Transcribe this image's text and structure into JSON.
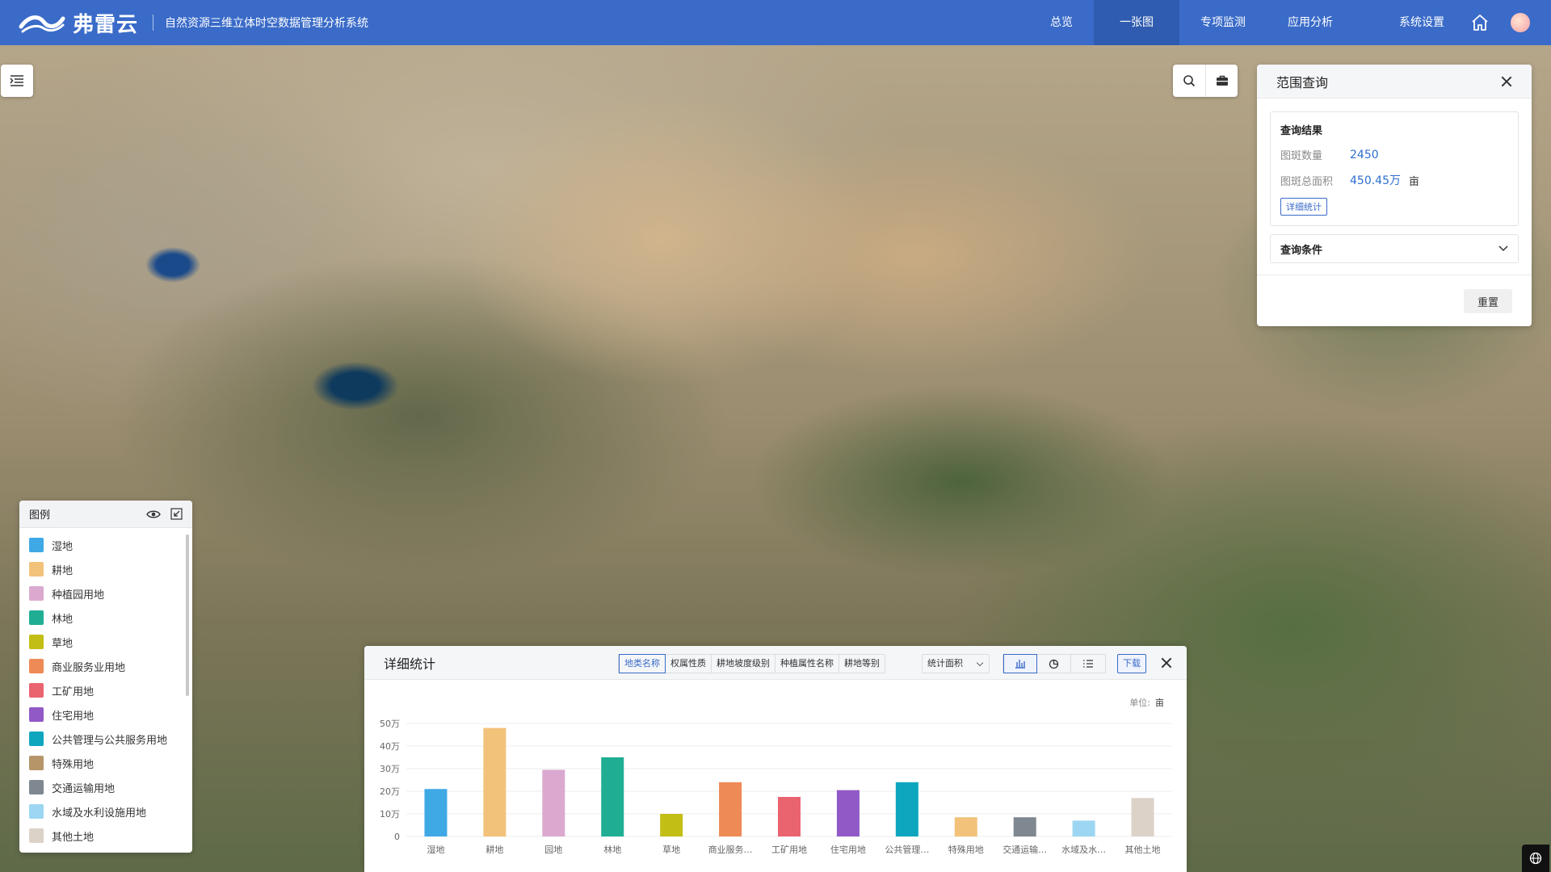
{
  "header": {
    "brand": "弗雷云",
    "system_title": "自然资源三维立体时空数据管理分析系统",
    "nav": [
      {
        "label": "总览",
        "active": false
      },
      {
        "label": "一张图",
        "active": true
      },
      {
        "label": "专项监测",
        "active": false
      },
      {
        "label": "应用分析",
        "active": false
      },
      {
        "label": "系统设置",
        "active": false
      }
    ],
    "colors": {
      "bar": "#3a6bc8",
      "active": "#2f5cb0"
    }
  },
  "range_query": {
    "title": "范围查询",
    "result_title": "查询结果",
    "count_label": "图斑数量",
    "count_value": "2450",
    "area_label": "图斑总面积",
    "area_value": "450.45万",
    "area_unit": "亩",
    "detail_button": "详细统计",
    "conditions_label": "查询条件",
    "reset_button": "重置"
  },
  "legend": {
    "title": "图例",
    "items": [
      {
        "label": "湿地",
        "color": "#3fa9e6"
      },
      {
        "label": "耕地",
        "color": "#f2c27a"
      },
      {
        "label": "种植园用地",
        "color": "#dba9cf"
      },
      {
        "label": "林地",
        "color": "#1fae94"
      },
      {
        "label": "草地",
        "color": "#c3be16"
      },
      {
        "label": "商业服务业用地",
        "color": "#ee8a55"
      },
      {
        "label": "工矿用地",
        "color": "#ea6470"
      },
      {
        "label": "住宅用地",
        "color": "#9159c6"
      },
      {
        "label": "公共管理与公共服务用地",
        "color": "#0ea6bf"
      },
      {
        "label": "特殊用地",
        "color": "#b69569"
      },
      {
        "label": "交通运输用地",
        "color": "#7f8791"
      },
      {
        "label": "水域及水利设施用地",
        "color": "#9cd6f2"
      },
      {
        "label": "其他土地",
        "color": "#dcd2c8"
      }
    ]
  },
  "stats": {
    "title": "详细统计",
    "tabs": [
      {
        "label": "地类名称",
        "active": true
      },
      {
        "label": "权属性质",
        "active": false
      },
      {
        "label": "耕地坡度级别",
        "active": false
      },
      {
        "label": "种植属性名称",
        "active": false
      },
      {
        "label": "耕地等别",
        "active": false
      }
    ],
    "metric_select": "统计面积",
    "download": "下载",
    "unit_label": "单位:",
    "unit_value": "亩"
  },
  "chart_data": {
    "type": "bar",
    "categories": [
      "湿地",
      "耕地",
      "园地",
      "林地",
      "草地",
      "商业服务…",
      "工矿用地",
      "住宅用地",
      "公共管理…",
      "特殊用地",
      "交通运输…",
      "水域及水…",
      "其他土地"
    ],
    "values": [
      210000,
      480000,
      295000,
      350000,
      100000,
      240000,
      175000,
      205000,
      240000,
      85000,
      85000,
      70000,
      170000
    ],
    "colors": [
      "#3fa9e6",
      "#f2c27a",
      "#dba9cf",
      "#1fae94",
      "#c3be16",
      "#ee8a55",
      "#ea6470",
      "#9159c6",
      "#0ea6bf",
      "#f2c27a",
      "#7f8791",
      "#9cd6f2",
      "#dcd2c8"
    ],
    "yticks": [
      "0",
      "10万",
      "20万",
      "30万",
      "40万",
      "50万"
    ],
    "ylim": [
      0,
      500000
    ],
    "grid": true
  }
}
